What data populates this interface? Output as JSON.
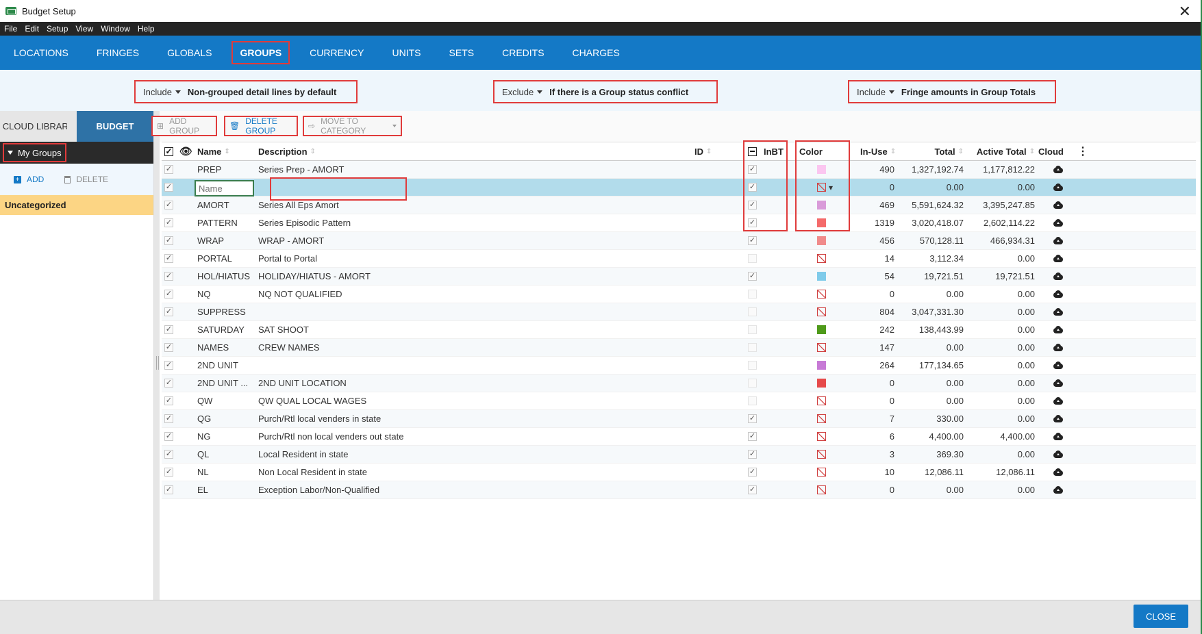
{
  "window": {
    "title": "Budget Setup",
    "close_glyph": "✕"
  },
  "menu": [
    "File",
    "Edit",
    "Setup",
    "View",
    "Window",
    "Help"
  ],
  "tabs": [
    {
      "label": "LOCATIONS",
      "active": false
    },
    {
      "label": "FRINGES",
      "active": false
    },
    {
      "label": "GLOBALS",
      "active": false
    },
    {
      "label": "GROUPS",
      "active": true
    },
    {
      "label": "CURRENCY",
      "active": false
    },
    {
      "label": "UNITS",
      "active": false
    },
    {
      "label": "SETS",
      "active": false
    },
    {
      "label": "CREDITS",
      "active": false
    },
    {
      "label": "CHARGES",
      "active": false
    }
  ],
  "options": [
    {
      "mode": "Include",
      "desc": "Non-grouped detail lines by default"
    },
    {
      "mode": "Exclude",
      "desc": "If there is a Group status conflict"
    },
    {
      "mode": "Include",
      "desc": "Fringe amounts in Group Totals"
    }
  ],
  "sidebar": {
    "tab_cloud": "CLOUD LIBRARY",
    "tab_budget": "BUDGET",
    "section": "My Groups",
    "add_label": "ADD",
    "delete_label": "DELETE",
    "category": "Uncategorized"
  },
  "toolbar": {
    "add_group": "ADD GROUP",
    "delete_group": "DELETE GROUP",
    "move_to_category": "MOVE TO CATEGORY"
  },
  "columns": {
    "name": "Name",
    "description": "Description",
    "id": "ID",
    "inbt": "InBT",
    "color": "Color",
    "inuse": "In-Use",
    "total": "Total",
    "active_total": "Active Total",
    "cloud": "Cloud"
  },
  "new_row": {
    "name_placeholder": "Name",
    "inuse": "0",
    "total": "0.00",
    "active_total": "0.00"
  },
  "rows": [
    {
      "name": "PREP",
      "desc": "Series Prep - AMORT",
      "inbt": true,
      "color": "#fbc6f0",
      "inuse": "490",
      "total": "1,327,192.74",
      "active": "1,177,812.22"
    },
    {
      "name": "AMORT",
      "desc": "Series All Eps Amort",
      "inbt": true,
      "color": "#d99bd9",
      "inuse": "469",
      "total": "5,591,624.32",
      "active": "3,395,247.85"
    },
    {
      "name": "PATTERN",
      "desc": "Series Episodic Pattern",
      "inbt": true,
      "color": "#f46a6a",
      "inuse": "1319",
      "total": "3,020,418.07",
      "active": "2,602,114.22"
    },
    {
      "name": "WRAP",
      "desc": "WRAP - AMORT",
      "inbt": true,
      "color": "#f08b8b",
      "inuse": "456",
      "total": "570,128.11",
      "active": "466,934.31"
    },
    {
      "name": "PORTAL",
      "desc": "Portal to Portal",
      "inbt": false,
      "color": "none",
      "inuse": "14",
      "total": "3,112.34",
      "active": "0.00"
    },
    {
      "name": "HOL/HIATUS",
      "desc": "HOLIDAY/HIATUS - AMORT",
      "inbt": true,
      "color": "#7fcbea",
      "inuse": "54",
      "total": "19,721.51",
      "active": "19,721.51"
    },
    {
      "name": "NQ",
      "desc": "NQ NOT QUALIFIED",
      "inbt": false,
      "color": "none",
      "inuse": "0",
      "total": "0.00",
      "active": "0.00"
    },
    {
      "name": "SUPPRESS",
      "desc": "",
      "inbt": false,
      "color": "none",
      "inuse": "804",
      "total": "3,047,331.30",
      "active": "0.00"
    },
    {
      "name": "SATURDAY",
      "desc": "SAT SHOOT",
      "inbt": false,
      "color": "#4e9a1a",
      "inuse": "242",
      "total": "138,443.99",
      "active": "0.00"
    },
    {
      "name": "NAMES",
      "desc": "CREW NAMES",
      "inbt": false,
      "color": "none",
      "inuse": "147",
      "total": "0.00",
      "active": "0.00"
    },
    {
      "name": "2ND UNIT",
      "desc": "",
      "inbt": false,
      "color": "#c77ad6",
      "inuse": "264",
      "total": "177,134.65",
      "active": "0.00"
    },
    {
      "name": "2ND UNIT ...",
      "desc": "2ND UNIT LOCATION",
      "inbt": false,
      "color": "#e64a4a",
      "inuse": "0",
      "total": "0.00",
      "active": "0.00"
    },
    {
      "name": "QW",
      "desc": "QW QUAL LOCAL WAGES",
      "inbt": false,
      "color": "none",
      "inuse": "0",
      "total": "0.00",
      "active": "0.00"
    },
    {
      "name": "QG",
      "desc": "Purch/Rtl local venders in state",
      "inbt": true,
      "color": "none",
      "inuse": "7",
      "total": "330.00",
      "active": "0.00"
    },
    {
      "name": "NG",
      "desc": "Purch/Rtl non local venders out state",
      "inbt": true,
      "color": "none",
      "inuse": "6",
      "total": "4,400.00",
      "active": "4,400.00"
    },
    {
      "name": "QL",
      "desc": "Local Resident in state",
      "inbt": true,
      "color": "none",
      "inuse": "3",
      "total": "369.30",
      "active": "0.00"
    },
    {
      "name": "NL",
      "desc": "Non Local Resident in state",
      "inbt": true,
      "color": "none",
      "inuse": "10",
      "total": "12,086.11",
      "active": "12,086.11"
    },
    {
      "name": "EL",
      "desc": "Exception Labor/Non-Qualified",
      "inbt": true,
      "color": "none",
      "inuse": "0",
      "total": "0.00",
      "active": "0.00"
    }
  ],
  "footer": {
    "close_label": "CLOSE"
  }
}
